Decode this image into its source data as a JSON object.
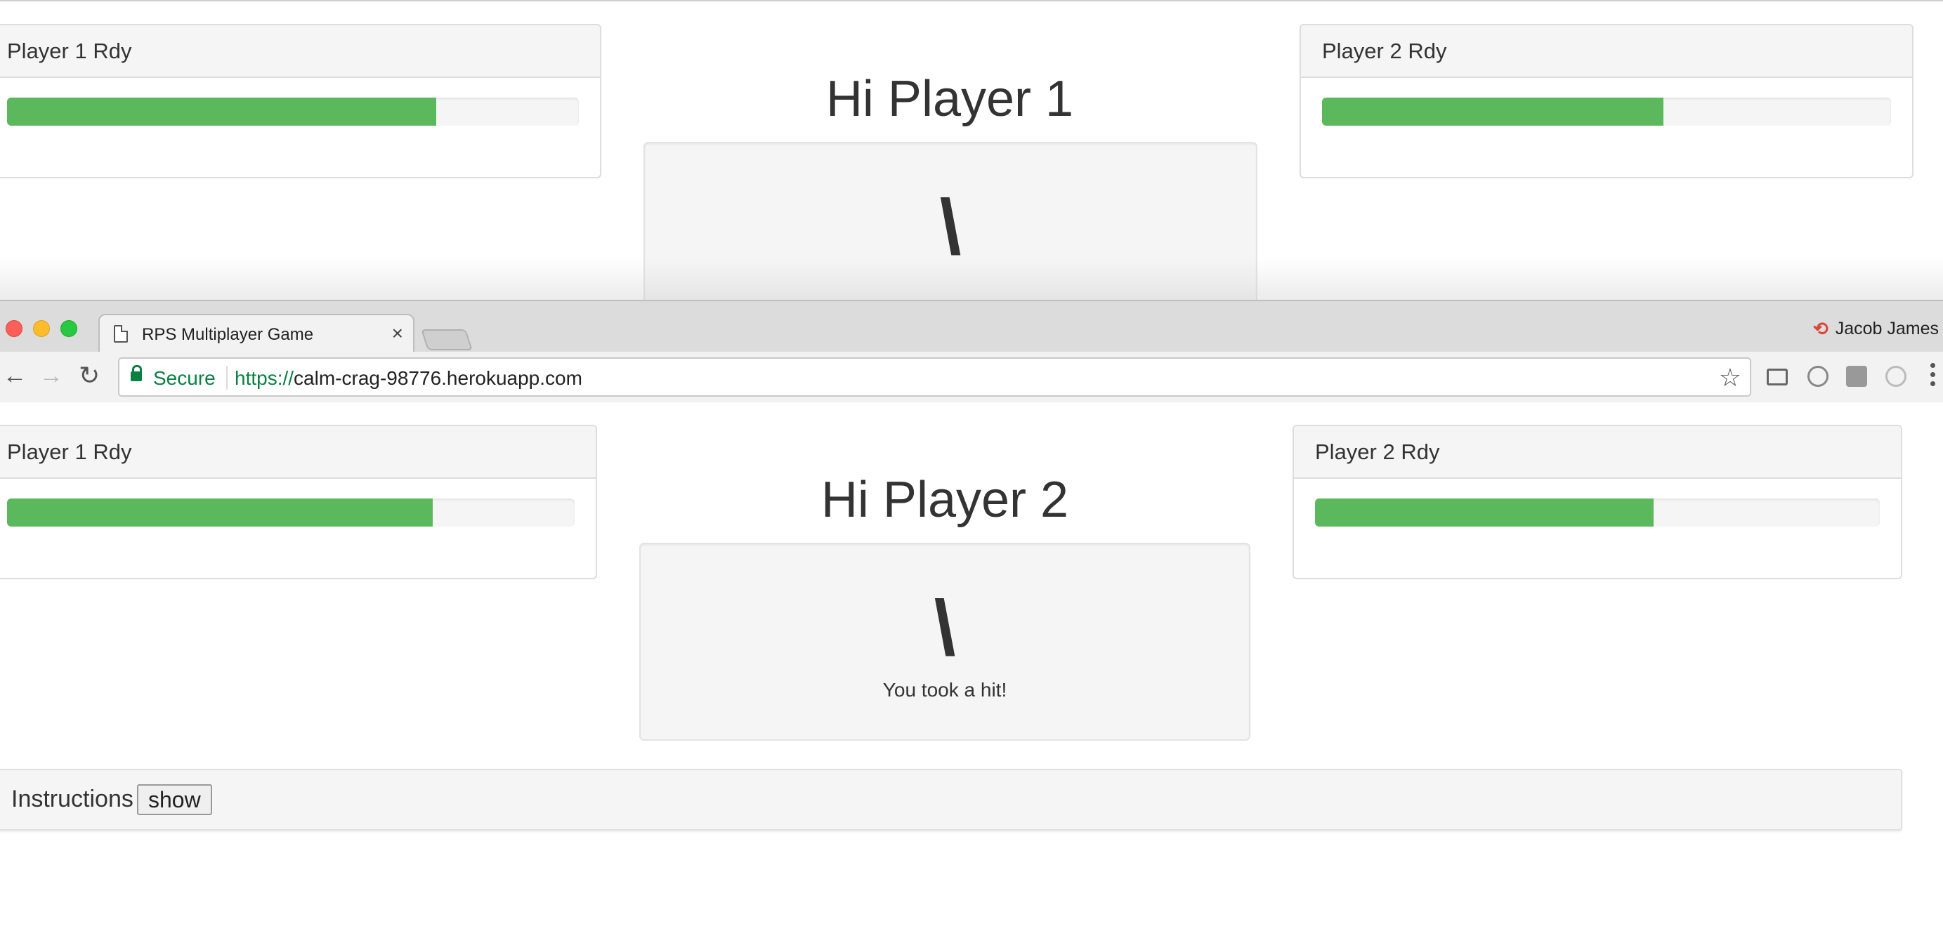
{
  "top_window": {
    "player1_panel": {
      "title": "Player 1 Rdy",
      "progress": 0.75
    },
    "player2_panel": {
      "title": "Player 2 Rdy",
      "progress": 0.6
    },
    "greeting": "Hi Player 1",
    "result_symbol": "\\"
  },
  "browser": {
    "tab_title": "RPS Multiplayer Game",
    "tab_close": "×",
    "profile_name": "Jacob James",
    "sync_icon": "sync-icon",
    "secure_label": "Secure",
    "url_scheme": "https://",
    "url_host": "calm-crag-98776.herokuapp.com",
    "back_glyph": "←",
    "forward_glyph": "→",
    "reload_glyph": "↻",
    "star_glyph": "☆"
  },
  "bottom_page": {
    "player1_panel": {
      "title": "Player 1 Rdy",
      "progress": 0.75
    },
    "player2_panel": {
      "title": "Player 2 Rdy",
      "progress": 0.6
    },
    "greeting": "Hi Player 2",
    "result_symbol": "\\",
    "result_message": "You took a hit!",
    "instructions_label": "Instructions",
    "instructions_button": "show"
  },
  "colors": {
    "progress_fill": "#5cb85c",
    "panel_heading": "#f5f5f5",
    "secure_green": "#0b8043"
  }
}
